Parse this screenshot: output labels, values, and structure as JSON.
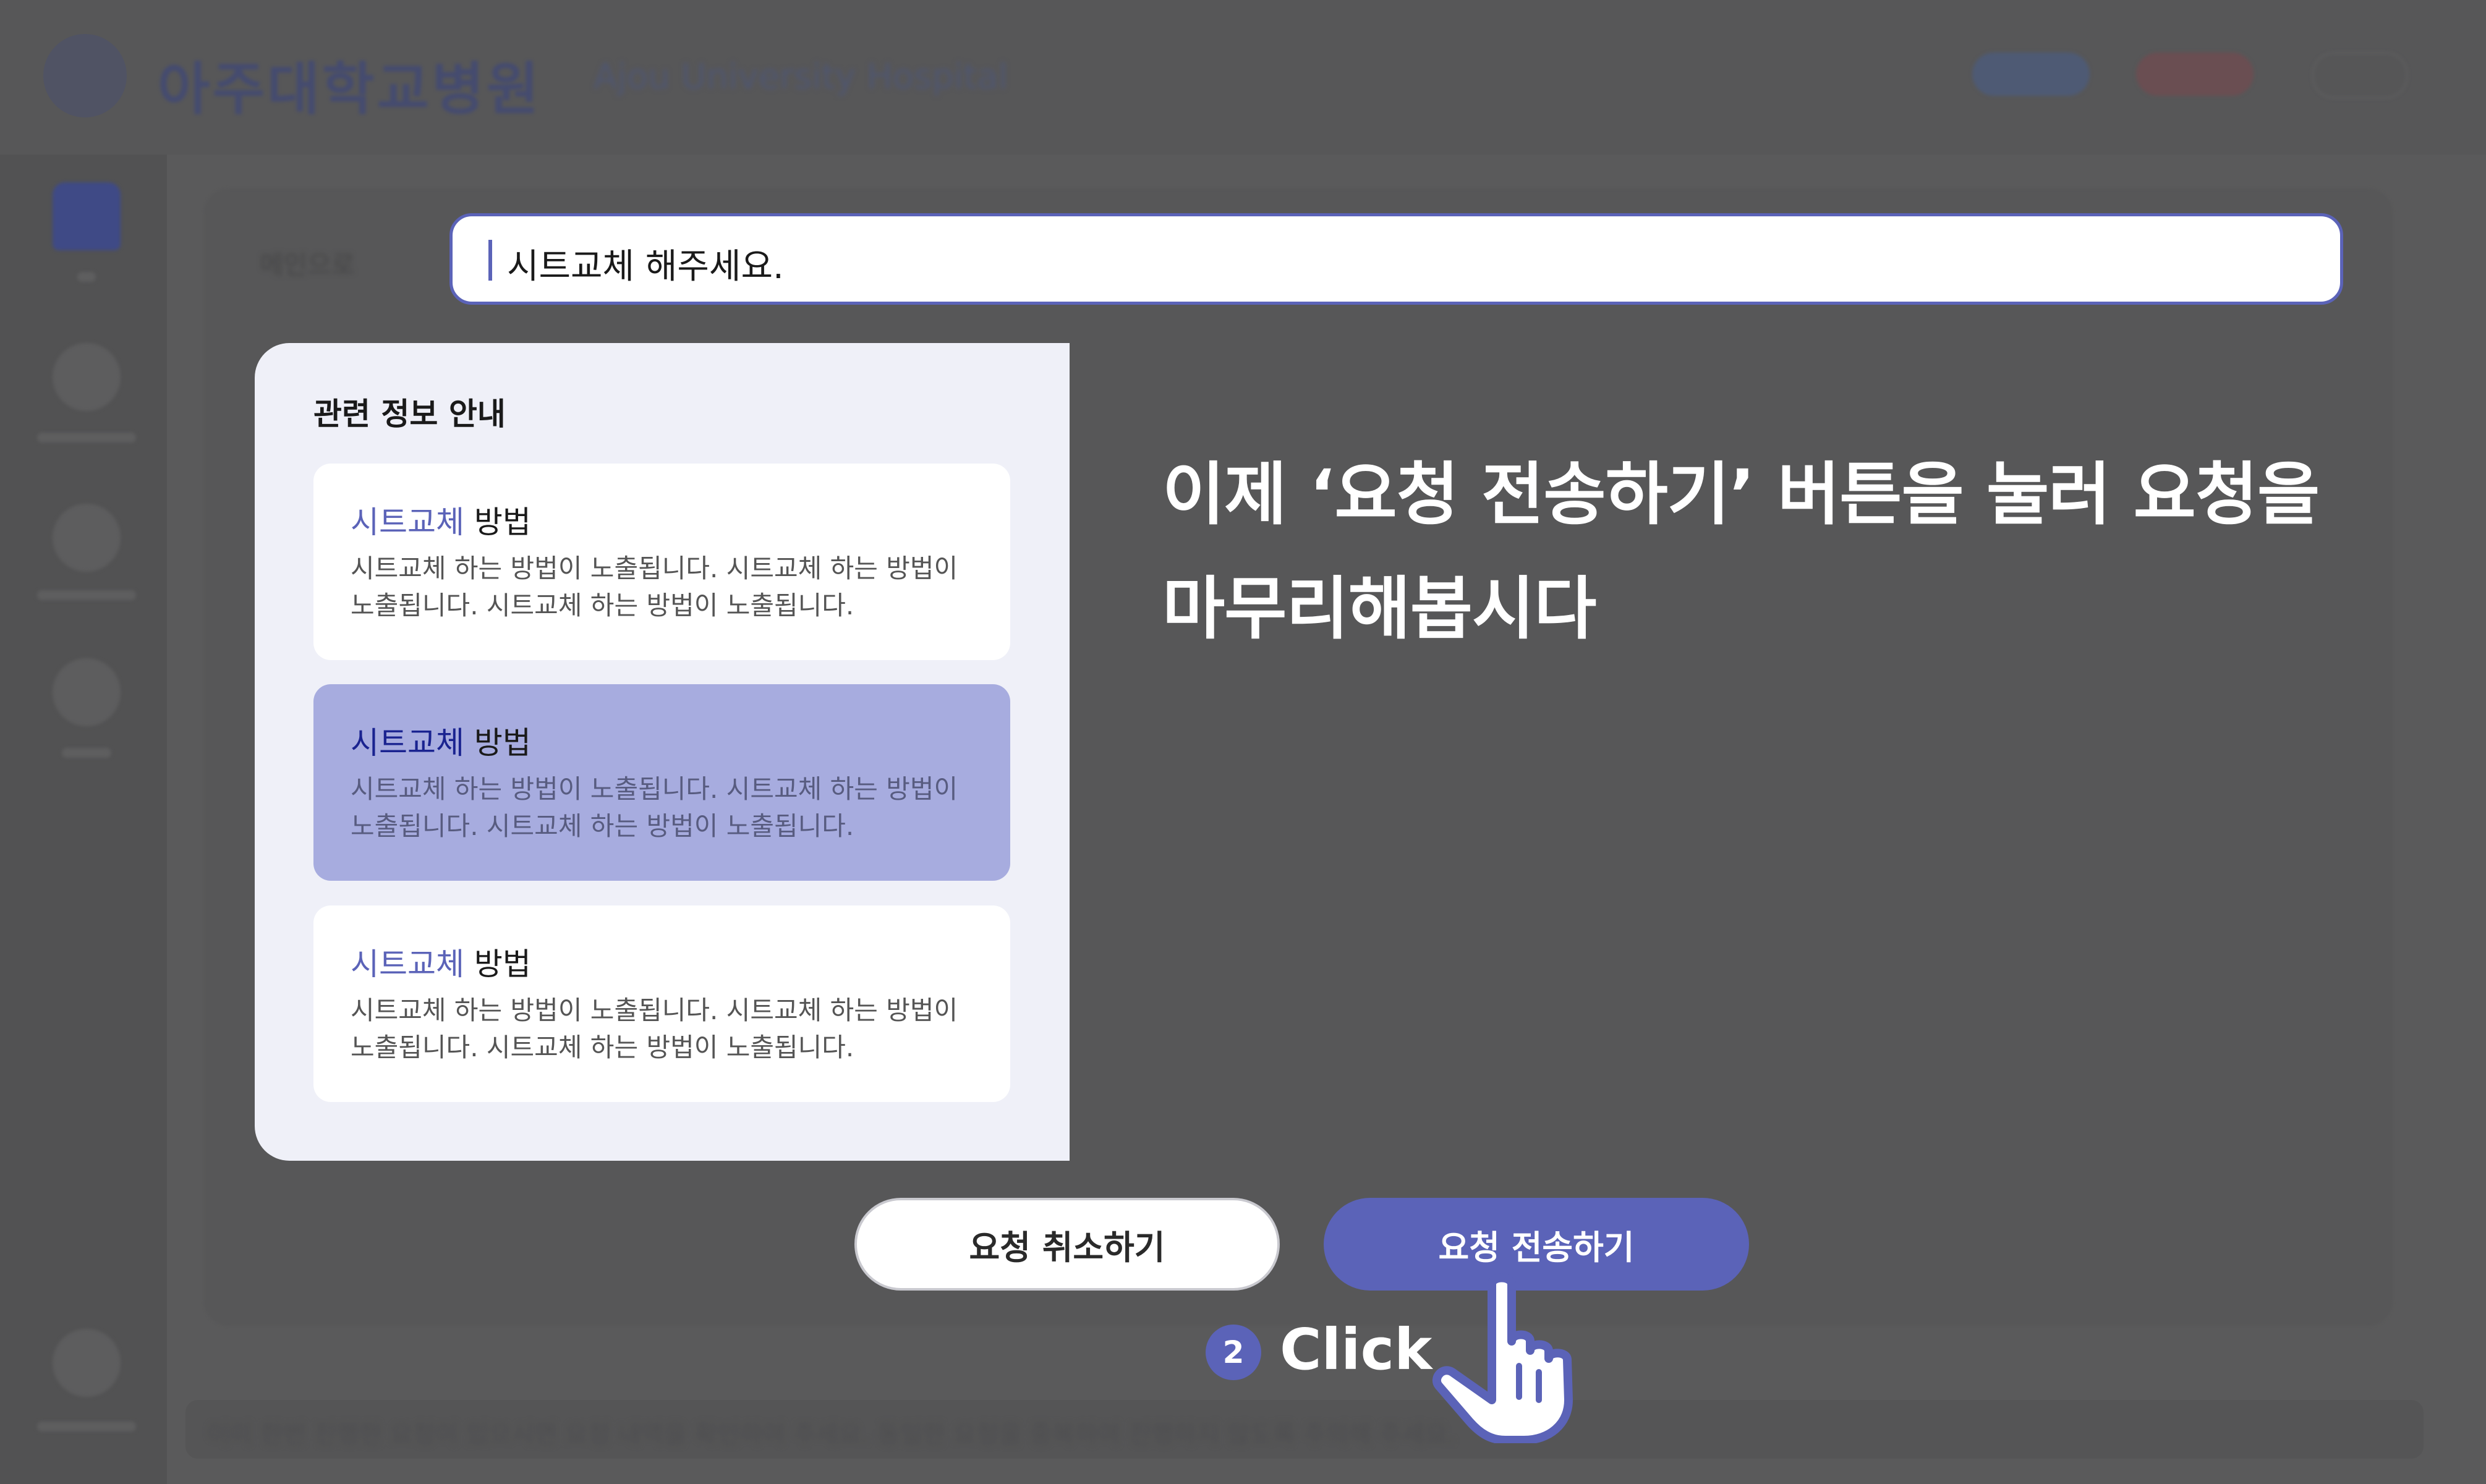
{
  "background": {
    "logo_text": "아주대학교병원",
    "logo_sub": "Ajou University Hospital",
    "breadcrumb": "메인으로",
    "footer_text": "이미 한번 진행한 요청이 있으시면 요청 내역을 확인하여 주세요. 동일한 요청을 중복하여 진행하지 않도록 주의해 주세요."
  },
  "search": {
    "value": "시트교체 해주세요."
  },
  "info_panel": {
    "title": "관련 정보 안내",
    "cards": [
      {
        "keyword": "시트교체",
        "title_rest": " 방법",
        "description": "시트교체 하는 방법이 노출됩니다. 시트교체 하는 방법이 노출됩니다. 시트교체 하는 방법이 노출됩니다."
      },
      {
        "keyword": "시트교체",
        "title_rest": " 방법",
        "description": "시트교체 하는 방법이 노출됩니다. 시트교체 하는 방법이 노출됩니다. 시트교체 하는 방법이 노출됩니다."
      },
      {
        "keyword": "시트교체",
        "title_rest": " 방법",
        "description": "시트교체 하는 방법이 노출됩니다. 시트교체 하는 방법이 노출됩니다. 시트교체 하는 방법이 노출됩니다."
      }
    ]
  },
  "guide": {
    "line1": "이제 ‘요청 전송하기’ 버튼을 눌러 요청을",
    "line2": "마무리해봅시다"
  },
  "actions": {
    "cancel_label": "요청 취소하기",
    "submit_label": "요청 전송하기"
  },
  "step": {
    "number": "2",
    "label": "Click"
  },
  "colors": {
    "accent": "#5b63b8",
    "highlight_card": "#a7acdf",
    "panel_bg": "#eff0f8",
    "overlay": "#4c4c4d"
  },
  "icons": {
    "cursor": "hand-pointer-icon"
  }
}
